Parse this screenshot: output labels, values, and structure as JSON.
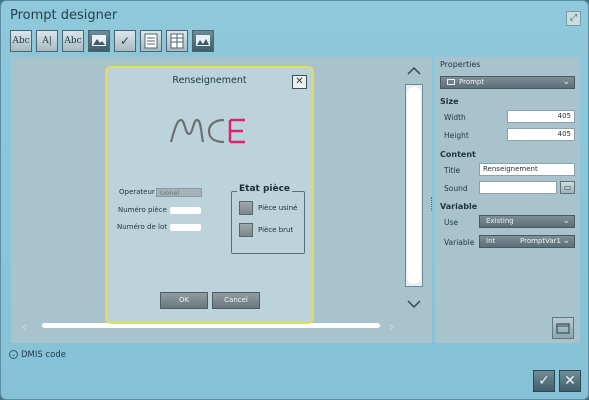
{
  "window": {
    "title": "Prompt designer"
  },
  "toolbar": {
    "tools": [
      {
        "name": "text-tool",
        "label": "Abc"
      },
      {
        "name": "text-field-tool",
        "label": "A|"
      },
      {
        "name": "edit-box-tool",
        "label": "Abc"
      },
      {
        "name": "image-tool",
        "label": ""
      },
      {
        "name": "checkbox-tool",
        "label": "✓"
      },
      {
        "name": "list-tool",
        "label": ""
      },
      {
        "name": "table-tool",
        "label": ""
      },
      {
        "name": "picture-tool",
        "label": ""
      }
    ]
  },
  "dialog": {
    "title": "Renseignement",
    "logo_text": "MCE",
    "operator_label": "Operateur",
    "operator_value": "Lionel",
    "part_number_label": "Numéro pièce",
    "lot_number_label": "Numéro de lot",
    "group_title": "Etat pièce",
    "checkbox1_label": "Pièce usiné",
    "checkbox2_label": "Pièce brut",
    "ok_label": "OK",
    "cancel_label": "Cancel"
  },
  "properties": {
    "header": "Properties",
    "object_selector": "Prompt",
    "size_header": "Size",
    "width_label": "Width",
    "width_value": "405",
    "height_label": "Height",
    "height_value": "405",
    "content_header": "Content",
    "title_label": "Title",
    "title_value": "Renseignement",
    "sound_label": "Sound",
    "sound_value": "",
    "variable_header": "Variable",
    "use_label": "Use",
    "use_value": "Existing",
    "variable_label": "Variable",
    "variable_type": "Int",
    "variable_value": "PromptVar1"
  },
  "footer": {
    "dmis_label": "DMIS code"
  },
  "colors": {
    "accent_border": "#e4dd57",
    "brand_pink": "#e0226e",
    "brand_gray": "#6d6f71"
  }
}
